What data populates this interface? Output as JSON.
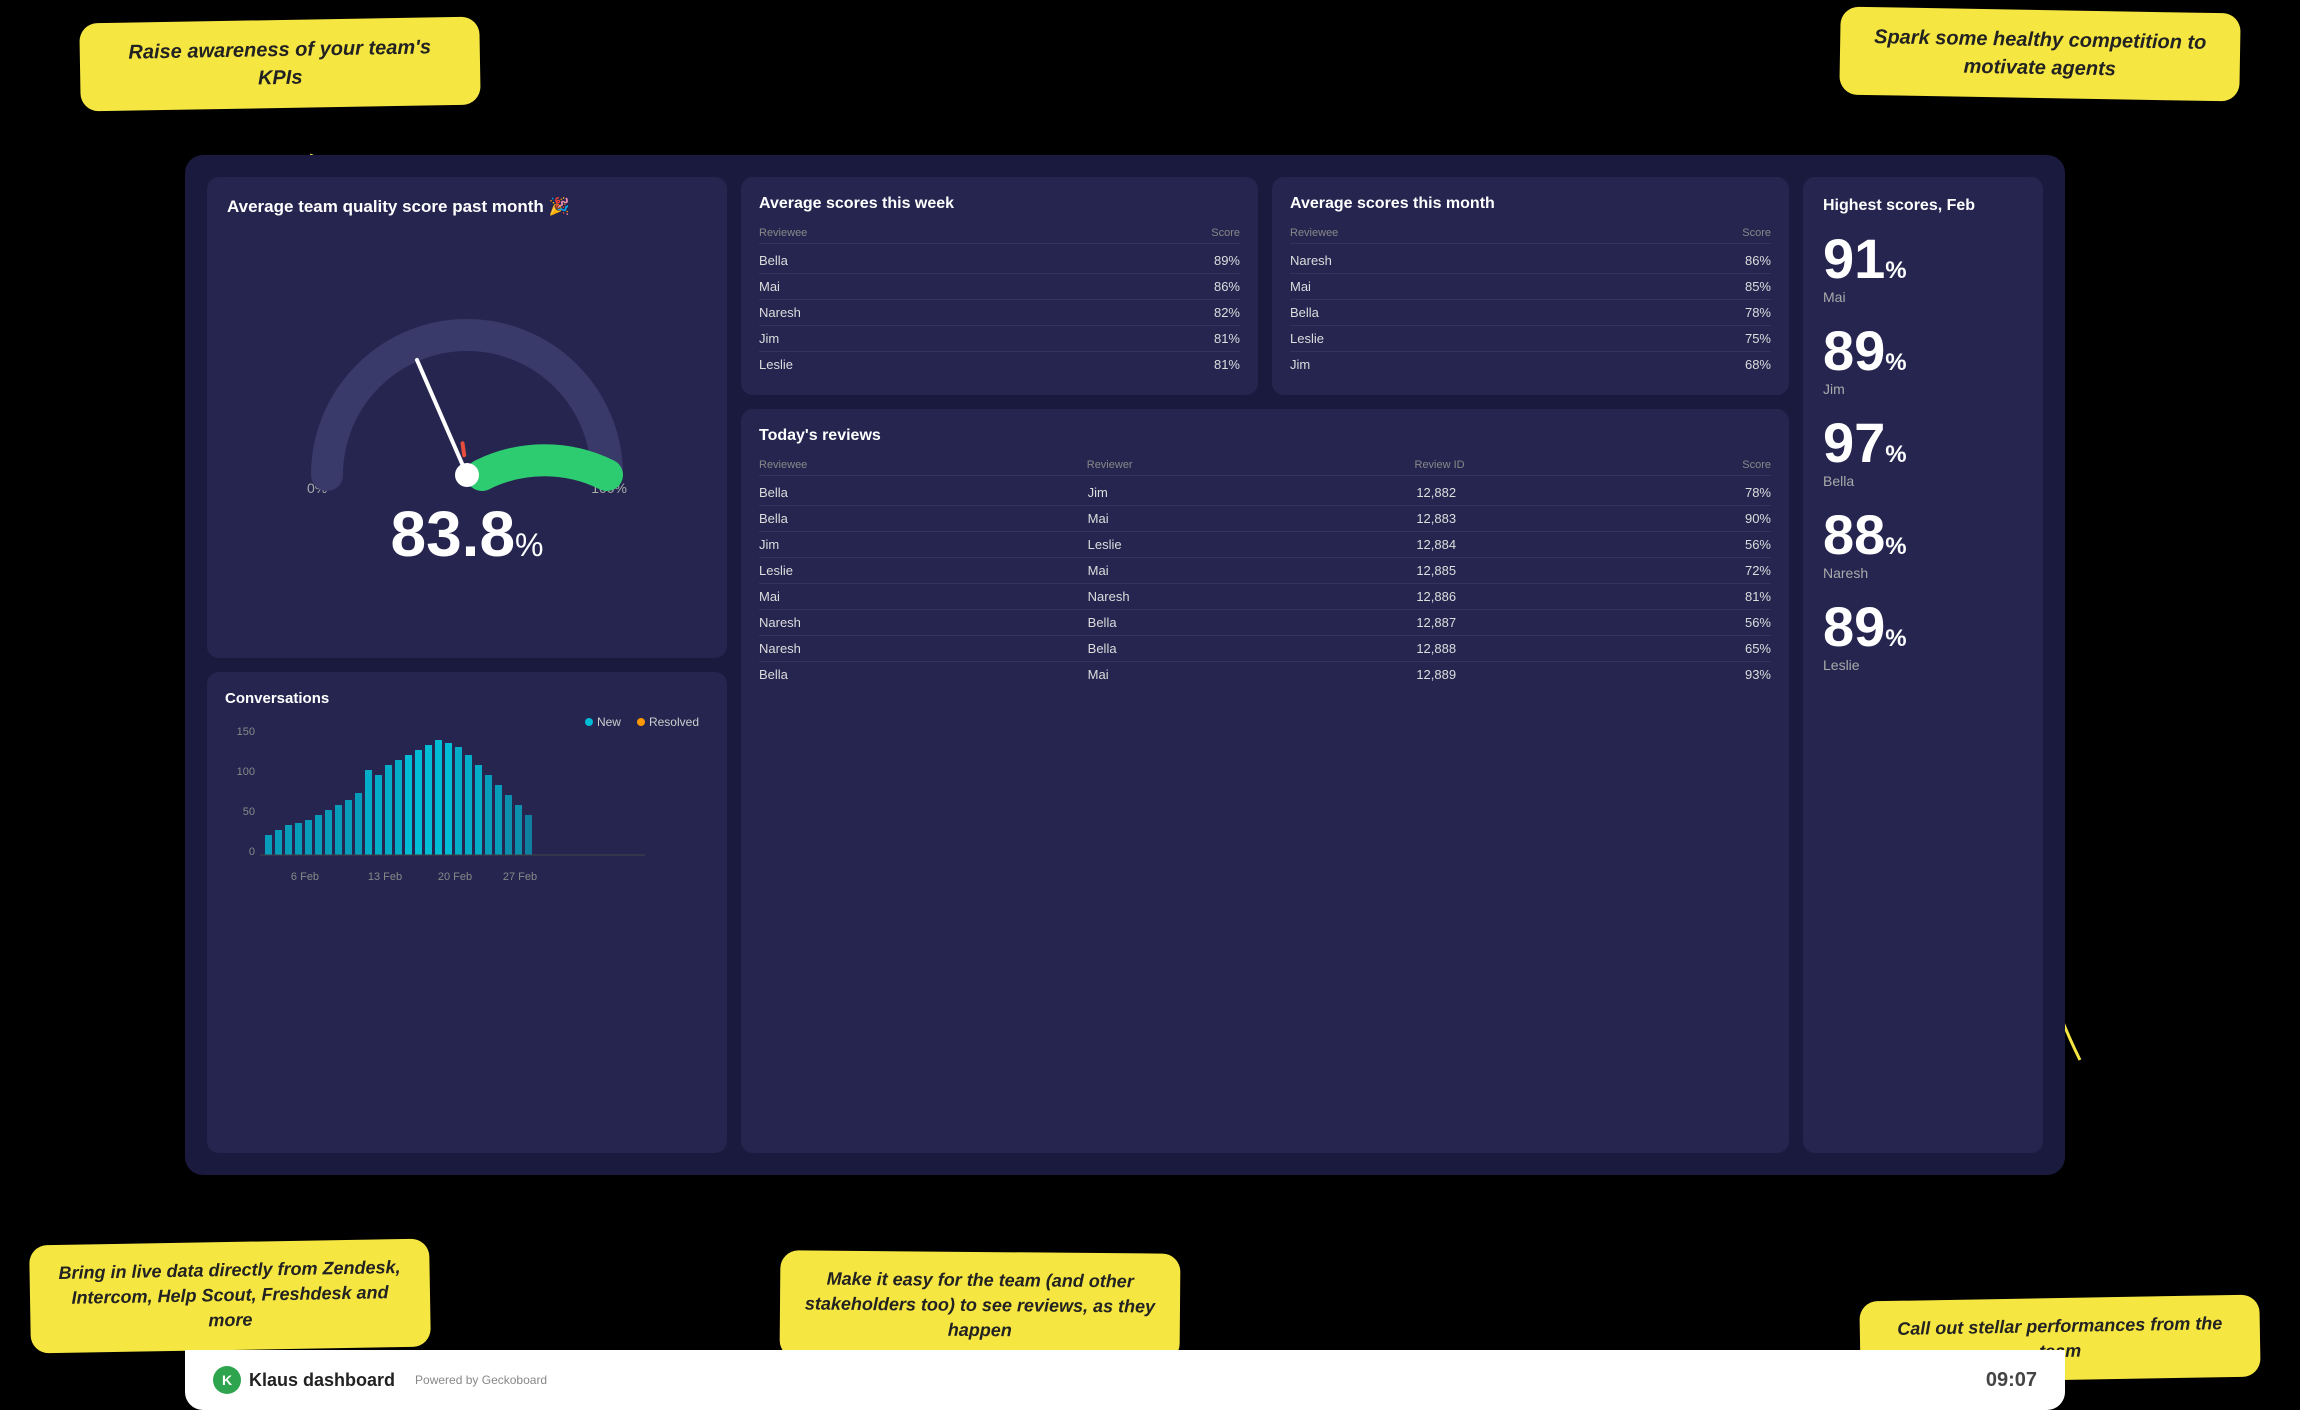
{
  "callouts": {
    "top_left": "Raise awareness of your team's KPIs",
    "top_right": "Spark some healthy competition to motivate agents",
    "bottom_left": "Bring in live data directly from Zendesk, Intercom, Help Scout, Freshdesk and more",
    "bottom_mid": "Make it easy for the team (and other stakeholders too) to see reviews, as they happen",
    "bottom_right": "Call out stellar performances from the team"
  },
  "gauge": {
    "title": "Average team quality score past month 🎉",
    "score": "83.8",
    "pct": "%",
    "label_min": "0%",
    "label_max": "100%"
  },
  "conversations": {
    "title": "Conversations",
    "y_labels": [
      "150",
      "100",
      "50",
      "0"
    ],
    "x_labels": [
      "6 Feb",
      "13 Feb",
      "20 Feb",
      "27 Feb"
    ],
    "legend_new": "New",
    "legend_resolved": "Resolved"
  },
  "scores_week": {
    "title": "Average scores this week",
    "header_reviewee": "Reviewee",
    "header_score": "Score",
    "rows": [
      {
        "reviewee": "Bella",
        "score": "89%"
      },
      {
        "reviewee": "Mai",
        "score": "86%"
      },
      {
        "reviewee": "Naresh",
        "score": "82%"
      },
      {
        "reviewee": "Jim",
        "score": "81%"
      },
      {
        "reviewee": "Leslie",
        "score": "81%"
      }
    ]
  },
  "scores_month": {
    "title": "Average scores this month",
    "header_reviewee": "Reviewee",
    "header_score": "Score",
    "rows": [
      {
        "reviewee": "Naresh",
        "score": "86%"
      },
      {
        "reviewee": "Mai",
        "score": "85%"
      },
      {
        "reviewee": "Bella",
        "score": "78%"
      },
      {
        "reviewee": "Leslie",
        "score": "75%"
      },
      {
        "reviewee": "Jim",
        "score": "68%"
      }
    ]
  },
  "reviews": {
    "title": "Today's reviews",
    "header_reviewee": "Reviewee",
    "header_reviewer": "Reviewer",
    "header_id": "Review ID",
    "header_score": "Score",
    "rows": [
      {
        "reviewee": "Bella",
        "reviewer": "Jim",
        "id": "12,882",
        "score": "78%"
      },
      {
        "reviewee": "Bella",
        "reviewer": "Mai",
        "id": "12,883",
        "score": "90%"
      },
      {
        "reviewee": "Jim",
        "reviewer": "Leslie",
        "id": "12,884",
        "score": "56%"
      },
      {
        "reviewee": "Leslie",
        "reviewer": "Mai",
        "id": "12,885",
        "score": "72%"
      },
      {
        "reviewee": "Mai",
        "reviewer": "Naresh",
        "id": "12,886",
        "score": "81%"
      },
      {
        "reviewee": "Naresh",
        "reviewer": "Bella",
        "id": "12,887",
        "score": "56%"
      },
      {
        "reviewee": "Naresh",
        "reviewer": "Bella",
        "id": "12,888",
        "score": "65%"
      },
      {
        "reviewee": "Bella",
        "reviewer": "Mai",
        "id": "12,889",
        "score": "93%"
      }
    ]
  },
  "highest_scores": {
    "title": "Highest scores, Feb",
    "items": [
      {
        "score": "91",
        "name": "Mai"
      },
      {
        "score": "89",
        "name": "Jim"
      },
      {
        "score": "97",
        "name": "Bella"
      },
      {
        "score": "88",
        "name": "Naresh"
      },
      {
        "score": "89",
        "name": "Leslie"
      }
    ]
  },
  "footer": {
    "brand": "Klaus dashboard",
    "powered": "Powered by Geckoboard",
    "time": "09:07"
  },
  "colors": {
    "accent_yellow": "#f5e642",
    "dashboard_bg": "#1a1a3e",
    "panel_bg": "#252550",
    "gauge_green": "#2ecc71",
    "gauge_red": "#e74c3c",
    "bar_teal": "#00bcd4",
    "bar_orange": "#ff9800"
  }
}
